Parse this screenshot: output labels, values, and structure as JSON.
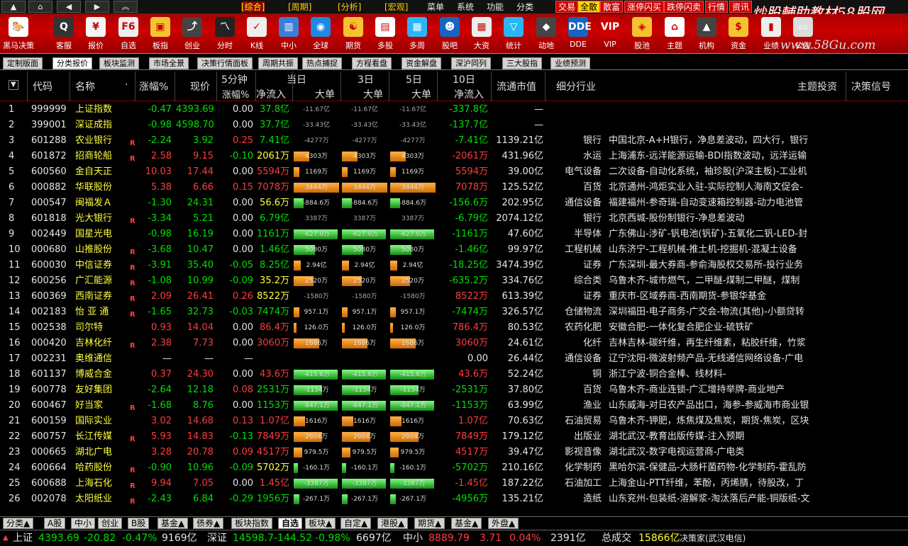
{
  "topbar": {
    "menu": [
      "[综合]",
      "[周期]",
      "[分析]",
      "[宏观]",
      "菜单",
      "系统",
      "功能",
      "分类"
    ],
    "red_tabs": [
      "交易",
      "全散",
      "散富",
      "涨停闪买",
      "跌停闪卖",
      "行情",
      "资讯"
    ],
    "logo_text": "炒股輔助教材58股网",
    "logo_url": "www.58Gu.com"
  },
  "toolbar": {
    "tools": [
      "黑马决策",
      "客服",
      "报价",
      "自选",
      "板指",
      "创业",
      "分时",
      "K线",
      "中小",
      "全球",
      "期货",
      "多股",
      "多周",
      "股吧",
      "大资",
      "统计",
      "动地",
      "DDE",
      "VIP",
      "股池",
      "主题",
      "机构",
      "资金",
      "业绩",
      "公告"
    ],
    "icons": [
      "horse-icon",
      "qq-icon",
      "yen-icon",
      "f6-icon",
      "index-icon",
      "growth-icon",
      "chart-icon",
      "kline-icon",
      "bar-icon",
      "globe-icon",
      "futures-icon",
      "multi-icon",
      "cycle-icon",
      "people-icon",
      "calendar-icon",
      "stats-icon",
      "fund-icon",
      "dde-icon",
      "vip-icon",
      "pool-icon",
      "home-icon",
      "bank-icon",
      "money-icon",
      "perf-icon",
      "notice-icon"
    ]
  },
  "subtabs": [
    "定制版面",
    "分类报价",
    "板块监测",
    "市场全景",
    "决策行情面板",
    "周期共振",
    "热点捕捉",
    "方程看盘",
    "资金解盘",
    "深沪同列",
    "三大股指",
    "业绩预测"
  ],
  "subtab_active": 1,
  "header": {
    "sort": "▼",
    "code": "代码",
    "name": "名称",
    "dot": "·",
    "change_pct": "涨幅%",
    "price": "现价",
    "five_min_top": "5分钟",
    "five_min_bottom": "涨幅%",
    "today_top": "当日",
    "today_inflow": "净流入",
    "today_big": "大单",
    "d3_top": "3日",
    "d3_big": "大单",
    "d5_top": "5日",
    "d5_big": "大单",
    "d10_top": "10日",
    "d10_inflow": "净流入",
    "mcap": "流通市值",
    "industry": "细分行业",
    "theme": "主题投资",
    "signal": "决策信号"
  },
  "rows": [
    {
      "no": "1",
      "code": "999999",
      "name": "上证指数",
      "m": "",
      "chg": "-0.47",
      "price": "4393.69",
      "f5": "0.00",
      "inflow": "37.8亿",
      "big": "-11.67亿",
      "big3": "-11.67亿",
      "big5": "-11.67亿",
      "d10": "-337.8亿",
      "mcap": "—",
      "ind": "",
      "theme": "",
      "dir": "down",
      "bar": "n",
      "bw": 0
    },
    {
      "no": "2",
      "code": "399001",
      "name": "深证成指",
      "m": "",
      "chg": "-0.98",
      "price": "4598.70",
      "f5": "0.00",
      "inflow": "37.7亿",
      "big": "-33.43亿",
      "big3": "-33.43亿",
      "big5": "-33.43亿",
      "d10": "-137.7亿",
      "mcap": "—",
      "ind": "",
      "theme": "",
      "dir": "down",
      "bar": "n",
      "bw": 0
    },
    {
      "no": "3",
      "code": "601288",
      "name": "农业银行",
      "m": "R",
      "chg": "-2.24",
      "price": "3.92",
      "f5": "0.25",
      "inflow": "7.41亿",
      "big": "-4277万",
      "big3": "-4277万",
      "big5": "-4277万",
      "d10": "-7.41亿",
      "mcap": "1139.21亿",
      "ind": "银行",
      "theme": "中国北京-A+H银行，净息差波动，四大行，银行",
      "dir": "down",
      "bar": "n",
      "bw": 0
    },
    {
      "no": "4",
      "code": "601872",
      "name": "招商轮船",
      "m": "R",
      "chg": "2.58",
      "price": "9.15",
      "f5": "-0.10",
      "inflow": "2061万",
      "big": "4303万",
      "big3": "4303万",
      "big5": "4303万",
      "d10": "-2061万",
      "mcap": "431.96亿",
      "ind": "水运",
      "theme": "上海浦东-远洋能源运输-BDI指数波动，远洋运输",
      "dir": "up",
      "bar": "o",
      "bw": 22
    },
    {
      "no": "5",
      "code": "600560",
      "name": "金自天正",
      "m": "",
      "chg": "10.03",
      "price": "17.44",
      "f5": "0.00",
      "inflow": "5594万",
      "big": "1169万",
      "big3": "1169万",
      "big5": "1169万",
      "d10": "5594万",
      "mcap": "39.00亿",
      "ind": "电气设备",
      "theme": "二次设备-自动化系统，袖珍股(沪深主板)-工业机",
      "dir": "up",
      "bar": "o",
      "bw": 8
    },
    {
      "no": "6",
      "code": "000882",
      "name": "华联股份",
      "m": "",
      "chg": "5.38",
      "price": "6.66",
      "f5": "0.15",
      "inflow": "7078万",
      "big": "3444万",
      "big3": "3444万",
      "big5": "3444万",
      "d10": "7078万",
      "mcap": "125.52亿",
      "ind": "百货",
      "theme": "北京通州-鸿炬实业入驻-实际控制人海南文促会-",
      "dir": "up",
      "bar": "o",
      "bw": 64
    },
    {
      "no": "7",
      "code": "000547",
      "name": "闽福发Ａ",
      "m": "",
      "chg": "-1.30",
      "price": "24.31",
      "f5": "0.00",
      "inflow": "56.6万",
      "big": "-884.6万",
      "big3": "-884.6万",
      "big5": "-884.6万",
      "d10": "-156.6万",
      "mcap": "202.95亿",
      "ind": "通信设备",
      "theme": "福建福州-参奇瑞-自动变速箱控制器-动力电池管",
      "dir": "down",
      "bar": "g",
      "bw": 14
    },
    {
      "no": "8",
      "code": "601818",
      "name": "光大银行",
      "m": "R",
      "chg": "-3.34",
      "price": "5.21",
      "f5": "0.00",
      "inflow": "6.79亿",
      "big": "3387万",
      "big3": "3387万",
      "big5": "3387万",
      "d10": "-6.79亿",
      "mcap": "2074.12亿",
      "ind": "银行",
      "theme": "北京西城-股份制银行-净息差波动",
      "dir": "down",
      "bar": "n",
      "bw": 0
    },
    {
      "no": "9",
      "code": "002449",
      "name": "国星光电",
      "m": "",
      "chg": "-0.98",
      "price": "16.19",
      "f5": "0.00",
      "inflow": "1161万",
      "big": "-627.0万",
      "big3": "-627.0万",
      "big5": "-627.0万",
      "d10": "-1161万",
      "mcap": "47.60亿",
      "ind": "半导体",
      "theme": "广东佛山-涉矿-钒电池(钒矿)-五氧化二钒-LED-封",
      "dir": "down",
      "bar": "g",
      "bw": 62
    },
    {
      "no": "10",
      "code": "000680",
      "name": "山推股份",
      "m": "R",
      "chg": "-3.68",
      "price": "10.47",
      "f5": "0.00",
      "inflow": "1.46亿",
      "big": "5080万",
      "big3": "5080万",
      "big5": "5080万",
      "d10": "-1.46亿",
      "mcap": "99.97亿",
      "ind": "工程机械",
      "theme": "山东济宁-工程机械-推土机-挖掘机-混凝土设备",
      "dir": "down",
      "bar": "g",
      "bw": 30
    },
    {
      "no": "11",
      "code": "600030",
      "name": "中信证券",
      "m": "R",
      "chg": "-3.91",
      "price": "35.40",
      "f5": "-0.05",
      "inflow": "8.25亿",
      "big": "2.94亿",
      "big3": "2.94亿",
      "big5": "2.94亿",
      "d10": "-18.25亿",
      "mcap": "3474.39亿",
      "ind": "证券",
      "theme": "广东深圳-最大券商-参俞海股权交易所-投行业务",
      "dir": "down",
      "bar": "o",
      "bw": 10
    },
    {
      "no": "12",
      "code": "600256",
      "name": "广汇能源",
      "m": "R",
      "chg": "-1.08",
      "price": "10.99",
      "f5": "-0.09",
      "inflow": "35.2万",
      "big": "2520万",
      "big3": "2520万",
      "big5": "2520万",
      "d10": "-635.2万",
      "mcap": "334.76亿",
      "ind": "综合类",
      "theme": "乌鲁木齐-城市燃气，二甲醚-煤制二甲醚，煤制",
      "dir": "down",
      "bar": "o",
      "bw": 28
    },
    {
      "no": "13",
      "code": "600369",
      "name": "西南证券",
      "m": "R",
      "chg": "2.09",
      "price": "26.41",
      "f5": "0.26",
      "inflow": "8522万",
      "big": "-1580万",
      "big3": "-1580万",
      "big5": "-1580万",
      "d10": "8522万",
      "mcap": "613.39亿",
      "ind": "证券",
      "theme": "重庆市-区域券商-西南期货-参银华基金",
      "dir": "up",
      "bar": "n",
      "bw": 0
    },
    {
      "no": "14",
      "code": "002183",
      "name": "怡 亚 通",
      "m": "R",
      "chg": "-1.65",
      "price": "32.73",
      "f5": "-0.03",
      "inflow": "7474万",
      "big": "957.1万",
      "big3": "957.1万",
      "big5": "957.1万",
      "d10": "-7474万",
      "mcap": "326.57亿",
      "ind": "仓储物流",
      "theme": "深圳福田-电子商务-广交会-物流(其他)-小额贷转",
      "dir": "down",
      "bar": "o",
      "bw": 8
    },
    {
      "no": "15",
      "code": "002538",
      "name": "司尔特",
      "m": "",
      "chg": "0.93",
      "price": "14.04",
      "f5": "0.00",
      "inflow": "86.4万",
      "big": "126.0万",
      "big3": "126.0万",
      "big5": "126.0万",
      "d10": "786.4万",
      "mcap": "80.53亿",
      "ind": "农药化肥",
      "theme": "安徽合肥-一体化复合肥企业-硫铁矿",
      "dir": "up",
      "bar": "o",
      "bw": 4
    },
    {
      "no": "16",
      "code": "000420",
      "name": "吉林化纤",
      "m": "R",
      "chg": "2.38",
      "price": "7.73",
      "f5": "0.00",
      "inflow": "3060万",
      "big": "1686万",
      "big3": "1686万",
      "big5": "1686万",
      "d10": "3060万",
      "mcap": "24.61亿",
      "ind": "化纤",
      "theme": "吉林吉林-碳纤维，再生纤维素，粘胶纤维，竹浆",
      "dir": "up",
      "bar": "o",
      "bw": 36
    },
    {
      "no": "17",
      "code": "002231",
      "name": "奥维通信",
      "m": "",
      "chg": "—",
      "price": "—",
      "f5": "—",
      "inflow": "",
      "big": "",
      "big3": "",
      "big5": "",
      "d10": "0.00",
      "mcap": "26.44亿",
      "ind": "通信设备",
      "theme": "辽宁沈阳-微波射频产品-无线通信网络设备-广电",
      "dir": "flat",
      "bar": "n",
      "bw": 0
    },
    {
      "no": "18",
      "code": "601137",
      "name": "博威合金",
      "m": "",
      "chg": "0.37",
      "price": "24.30",
      "f5": "0.00",
      "inflow": "43.6万",
      "big": "-415.6万",
      "big3": "-415.6万",
      "big5": "-415.6万",
      "d10": "43.6万",
      "mcap": "52.24亿",
      "ind": "铜",
      "theme": "浙江宁波-铜合金棒、线材料-",
      "dir": "up",
      "bar": "g",
      "bw": 62
    },
    {
      "no": "19",
      "code": "600778",
      "name": "友好集团",
      "m": "",
      "chg": "-2.64",
      "price": "12.18",
      "f5": "0.08",
      "inflow": "2531万",
      "big": "-1134万",
      "big3": "-1134万",
      "big5": "-1134万",
      "d10": "-2531万",
      "mcap": "37.80亿",
      "ind": "百货",
      "theme": "乌鲁木齐-商业连锁-广汇增持举牌-商业地产",
      "dir": "down",
      "bar": "g",
      "bw": 40
    },
    {
      "no": "20",
      "code": "600467",
      "name": "好当家",
      "m": "R",
      "chg": "-1.68",
      "price": "8.76",
      "f5": "0.00",
      "inflow": "1153万",
      "big": "-847.1万",
      "big3": "-847.1万",
      "big5": "-847.1万",
      "d10": "-1153万",
      "mcap": "63.99亿",
      "ind": "渔业",
      "theme": "山东威海-对日农产品出口，海参-参威海市商业银",
      "dir": "down",
      "bar": "g",
      "bw": 62
    },
    {
      "no": "21",
      "code": "600159",
      "name": "国际实业",
      "m": "",
      "chg": "3.02",
      "price": "14.68",
      "f5": "0.13",
      "inflow": "1.07亿",
      "big": "1616万",
      "big3": "1616万",
      "big5": "1616万",
      "d10": "1.07亿",
      "mcap": "70.63亿",
      "ind": "石油贸易",
      "theme": "乌鲁木齐-钾肥，炼焦煤及焦炭，期货-焦炭，区块",
      "dir": "up",
      "bar": "o",
      "bw": 16
    },
    {
      "no": "22",
      "code": "600757",
      "name": "长江传媒",
      "m": "R",
      "chg": "5.93",
      "price": "14.83",
      "f5": "-0.13",
      "inflow": "7849万",
      "big": "2604万",
      "big3": "2604万",
      "big5": "2604万",
      "d10": "7849万",
      "mcap": "179.12亿",
      "ind": "出版业",
      "theme": "湖北武汉-教育出版传媒-注入预期",
      "dir": "up",
      "bar": "o",
      "bw": 40
    },
    {
      "no": "23",
      "code": "000665",
      "name": "湖北广电",
      "m": "",
      "chg": "3.28",
      "price": "20.78",
      "f5": "0.09",
      "inflow": "4517万",
      "big": "979.5万",
      "big3": "979.5万",
      "big5": "979.5万",
      "d10": "4517万",
      "mcap": "39.47亿",
      "ind": "影视音像",
      "theme": "湖北武汉-数字电视运营商-广电类",
      "dir": "up",
      "bar": "o",
      "bw": 12
    },
    {
      "no": "24",
      "code": "600664",
      "name": "哈药股份",
      "m": "R",
      "chg": "-0.90",
      "price": "10.96",
      "f5": "-0.09",
      "inflow": "5702万",
      "big": "-160.1万",
      "big3": "-160.1万",
      "big5": "-160.1万",
      "d10": "-5702万",
      "mcap": "210.16亿",
      "ind": "化学制药",
      "theme": "黑哈尔滨-保健品-大肠杆菌药物-化学制药-霍乱防",
      "dir": "down",
      "bar": "g",
      "bw": 6
    },
    {
      "no": "25",
      "code": "600688",
      "name": "上海石化",
      "m": "R",
      "chg": "9.94",
      "price": "7.05",
      "f5": "0.00",
      "inflow": "1.45亿",
      "big": "-3387万",
      "big3": "-3387万",
      "big5": "-3387万",
      "d10": "-1.45亿",
      "mcap": "187.22亿",
      "ind": "石油加工",
      "theme": "上海金山-PTT纤维，苯酚，丙烯腈，待股改，丁",
      "dir": "up",
      "bar": "g",
      "bw": 62
    },
    {
      "no": "26",
      "code": "002078",
      "name": "太阳纸业",
      "m": "R",
      "chg": "-2.43",
      "price": "6.84",
      "f5": "-0.29",
      "inflow": "1956万",
      "big": "-267.1万",
      "big3": "-267.1万",
      "big5": "-267.1万",
      "d10": "-4956万",
      "mcap": "135.21亿",
      "ind": "造纸",
      "theme": "山东兖州-包装纸-溶解浆-淘汰落后产能-铜版纸-文",
      "dir": "down",
      "bar": "g",
      "bw": 8
    }
  ],
  "bottom_tabs": [
    "分类▲",
    "A股",
    "中小",
    "创业",
    "B股",
    "基金▲",
    "债券▲",
    "板块指数",
    "自选",
    "板块▲",
    "自定▲",
    "港股▲",
    "期货▲",
    "基金▲",
    "外盘▲"
  ],
  "bottom_tab_active": 8,
  "status": {
    "sh_label": "上证",
    "sh_price": "4393.69",
    "sh_chg": "-20.82",
    "sh_pct": "-0.47%",
    "sh_amt": "9169亿",
    "sz_label": "深证",
    "sz_price": "14598.7",
    "sz_chg": "-144.52",
    "sz_pct": "-0.98%",
    "sz_amt": "6697亿",
    "zx_label": "中小",
    "zx_price": "8889.79",
    "zx_chg": "3.71",
    "zx_pct": "0.04%",
    "zx_amt": "2391亿",
    "total_label": "总成交",
    "total_amt": "15866亿",
    "app_name": "决策家(武汉电信)"
  },
  "colors": {
    "up": "#ff3c3c",
    "down": "#00e000",
    "accent": "#cc0000",
    "neutral": "#e6e6e6"
  }
}
